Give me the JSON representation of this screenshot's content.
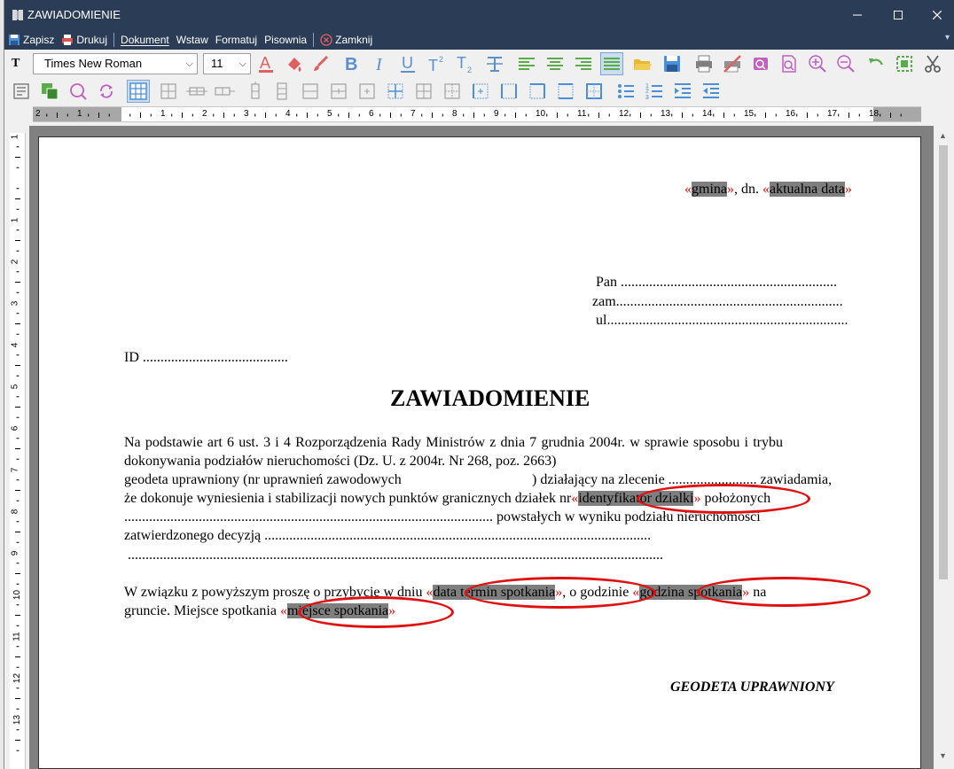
{
  "window": {
    "title": "ZAWIADOMIENIE"
  },
  "menu": {
    "save": "Zapisz",
    "print": "Drukuj",
    "document": "Dokument",
    "insert": "Wstaw",
    "format": "Formatuj",
    "spelling": "Pisownia",
    "close": "Zamknij"
  },
  "toolbar": {
    "font_name": "Times New Roman",
    "font_size": "11",
    "icons_row1": [
      "font-color-icon",
      "highlight-color-icon",
      "brush-icon",
      "bold-icon",
      "italic-icon",
      "underline-icon",
      "superscript-icon",
      "subscript-icon",
      "strikethrough-icon",
      "align-left-icon",
      "align-center-icon",
      "align-right-icon",
      "justify-icon",
      "open-folder-icon",
      "save-disk-icon",
      "print-icon",
      "no-print-icon",
      "preview-icon",
      "find-icon",
      "zoom-in-icon",
      "zoom-out-icon",
      "undo-icon",
      "select-frame-icon",
      "cut-icon"
    ],
    "icons_row2": [
      "paragraph-icon",
      "copy-format-icon",
      "search-circle-icon",
      "refresh-icon",
      "table-icon",
      "insert-row-icon",
      "insert-col-icon",
      "delete-row-icon",
      "delete-col-icon",
      "split-cell-icon",
      "merge-cell-icon",
      "border-icon",
      "border-all-icon",
      "border-inner-icon",
      "border-outer-icon",
      "border-left-icon",
      "border-right-icon",
      "border-top-icon",
      "border-bottom-icon",
      "bullet-list-icon",
      "numbered-list-icon",
      "indent-increase-icon",
      "indent-decrease-icon"
    ]
  },
  "ruler": {
    "h_numbers": [
      "2",
      "1",
      "1",
      "2",
      "3",
      "4",
      "5",
      "6",
      "7",
      "8",
      "9",
      "10",
      "11",
      "12",
      "13",
      "14",
      "15",
      "16",
      "17",
      "18"
    ],
    "v_numbers": [
      "1",
      "1",
      "2",
      "3",
      "4",
      "5",
      "6",
      "7",
      "8",
      "9",
      "10",
      "11",
      "12",
      "13"
    ]
  },
  "document": {
    "header": {
      "field_gmina": "gmina",
      "sep": ", dn. ",
      "field_date": "aktualna data"
    },
    "address": [
      "Pan .............................................................",
      "zam................................................................",
      "ul...................................................................."
    ],
    "id_line": "ID .........................................",
    "title": "ZAWIADOMIENIE",
    "body": {
      "line1": "Na podstawie art 6 ust. 3 i 4 Rozporządzenia Rady Ministrów z dnia 7 grudnia 2004r. w sprawie sposobu i trybu",
      "line2": "dokonywania podziałów nieruchomości (Dz. U. z 2004r. Nr 268, poz. 2663)",
      "line3a": "geodeta uprawniony (nr uprawnień zawodowych",
      "line3b": ") działający na zlecenie ......................... zawiadamia,",
      "line4a": "że dokonuje wyniesienia i stabilizacji nowych punktów granicznych działek nr",
      "field_parcel": "identyfikator dzialki",
      "line4b": " położonych",
      "line5": "........................................................................................................ powstałych w wyniku podziału nieruchomości",
      "line6": "zatwierdzonego decyzją .............................................................................................................",
      "line7": ".......................................................................................................................................................",
      "line8a": "W związku z powyższym proszę o przybycie w dniu ",
      "field_meeting_date": "data termin spotkania",
      "line8b": ", o godzinie ",
      "field_meeting_time": "godzina spotkania",
      "line8c": " na",
      "line9a": "gruncie. Miejsce spotkania ",
      "field_meeting_place": "miejsce spotkania"
    },
    "signature": "GEODETA UPRAWNIONY",
    "open_guil": "«",
    "close_guil": "»"
  }
}
